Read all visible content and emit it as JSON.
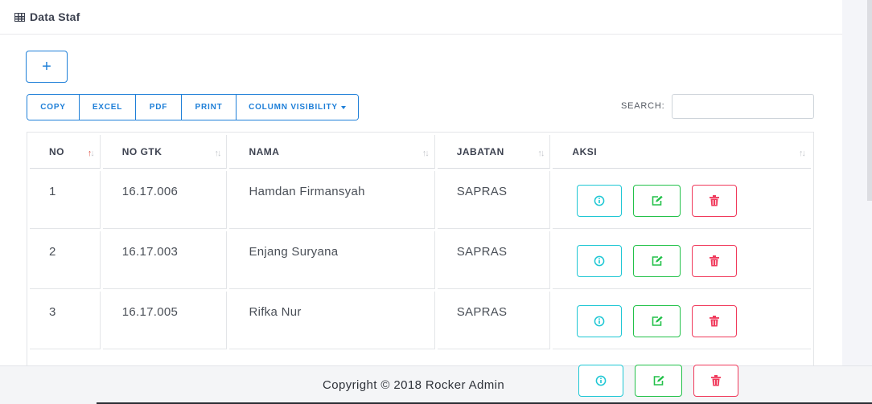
{
  "header": {
    "title": "Data Staf",
    "icon": "table-icon"
  },
  "toolbar": {
    "add_label": "+",
    "buttons": [
      "COPY",
      "EXCEL",
      "PDF",
      "PRINT",
      "COLUMN VISIBILITY"
    ],
    "search_label": "SEARCH:",
    "search_value": ""
  },
  "table": {
    "columns": [
      "NO",
      "NO GTK",
      "NAMA",
      "JABATAN",
      "AKSI"
    ],
    "rows": [
      {
        "no": "1",
        "gtk": "16.17.006",
        "nama": "Hamdan Firmansyah",
        "jabatan": "SAPRAS"
      },
      {
        "no": "2",
        "gtk": "16.17.003",
        "nama": "Enjang Suryana",
        "jabatan": "SAPRAS"
      },
      {
        "no": "3",
        "gtk": "16.17.005",
        "nama": "Rifka Nur",
        "jabatan": "SAPRAS"
      }
    ],
    "actions": [
      "info-icon",
      "edit-icon",
      "trash-icon"
    ]
  },
  "footer": {
    "copyright": "Copyright © 2018 Rocker Admin"
  },
  "colors": {
    "primary": "#1e7fd8",
    "info": "#1ec7d4",
    "success": "#23c14a",
    "danger": "#f0395b"
  }
}
